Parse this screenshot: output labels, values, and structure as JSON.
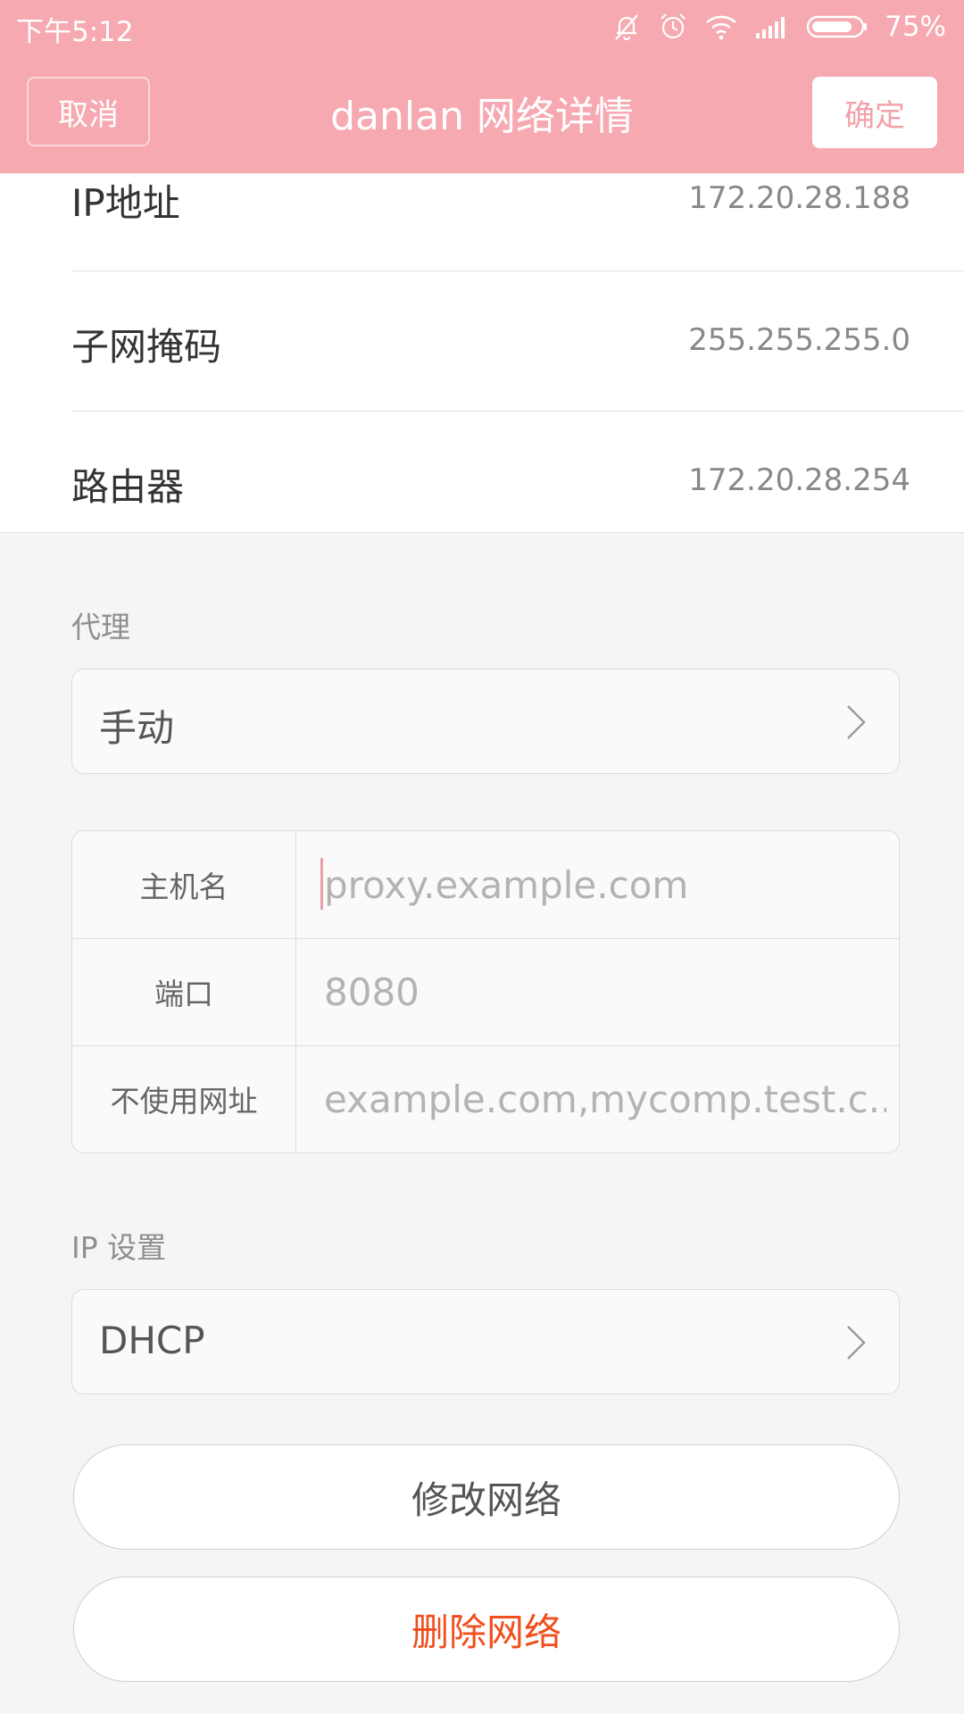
{
  "status_bar": {
    "time": "下午5:12",
    "battery_percent": "75%",
    "icons": [
      "mute-bell-icon",
      "alarm-icon",
      "wifi-icon",
      "signal-icon",
      "battery-icon"
    ]
  },
  "nav": {
    "cancel_label": "取消",
    "title": "danlan  网络详情",
    "confirm_label": "确定"
  },
  "info_rows": [
    {
      "label": "IP地址",
      "value": "172.20.28.188"
    },
    {
      "label": "子网掩码",
      "value": "255.255.255.0"
    },
    {
      "label": "路由器",
      "value": "172.20.28.254"
    }
  ],
  "proxy": {
    "section_label": "代理",
    "mode": "手动",
    "fields": [
      {
        "label": "主机名",
        "placeholder": "proxy.example.com"
      },
      {
        "label": "端口",
        "placeholder": "8080"
      },
      {
        "label": "不使用网址",
        "placeholder": "example.com,mycomp.test.c..."
      }
    ]
  },
  "ip_settings": {
    "section_label": "IP 设置",
    "mode": "DHCP"
  },
  "actions": {
    "modify_label": "修改网络",
    "delete_label": "删除网络"
  },
  "colors": {
    "header_pink": "#f6a9b0",
    "delete_red": "#f04e1c",
    "confirm_text": "#f3a1a9"
  }
}
